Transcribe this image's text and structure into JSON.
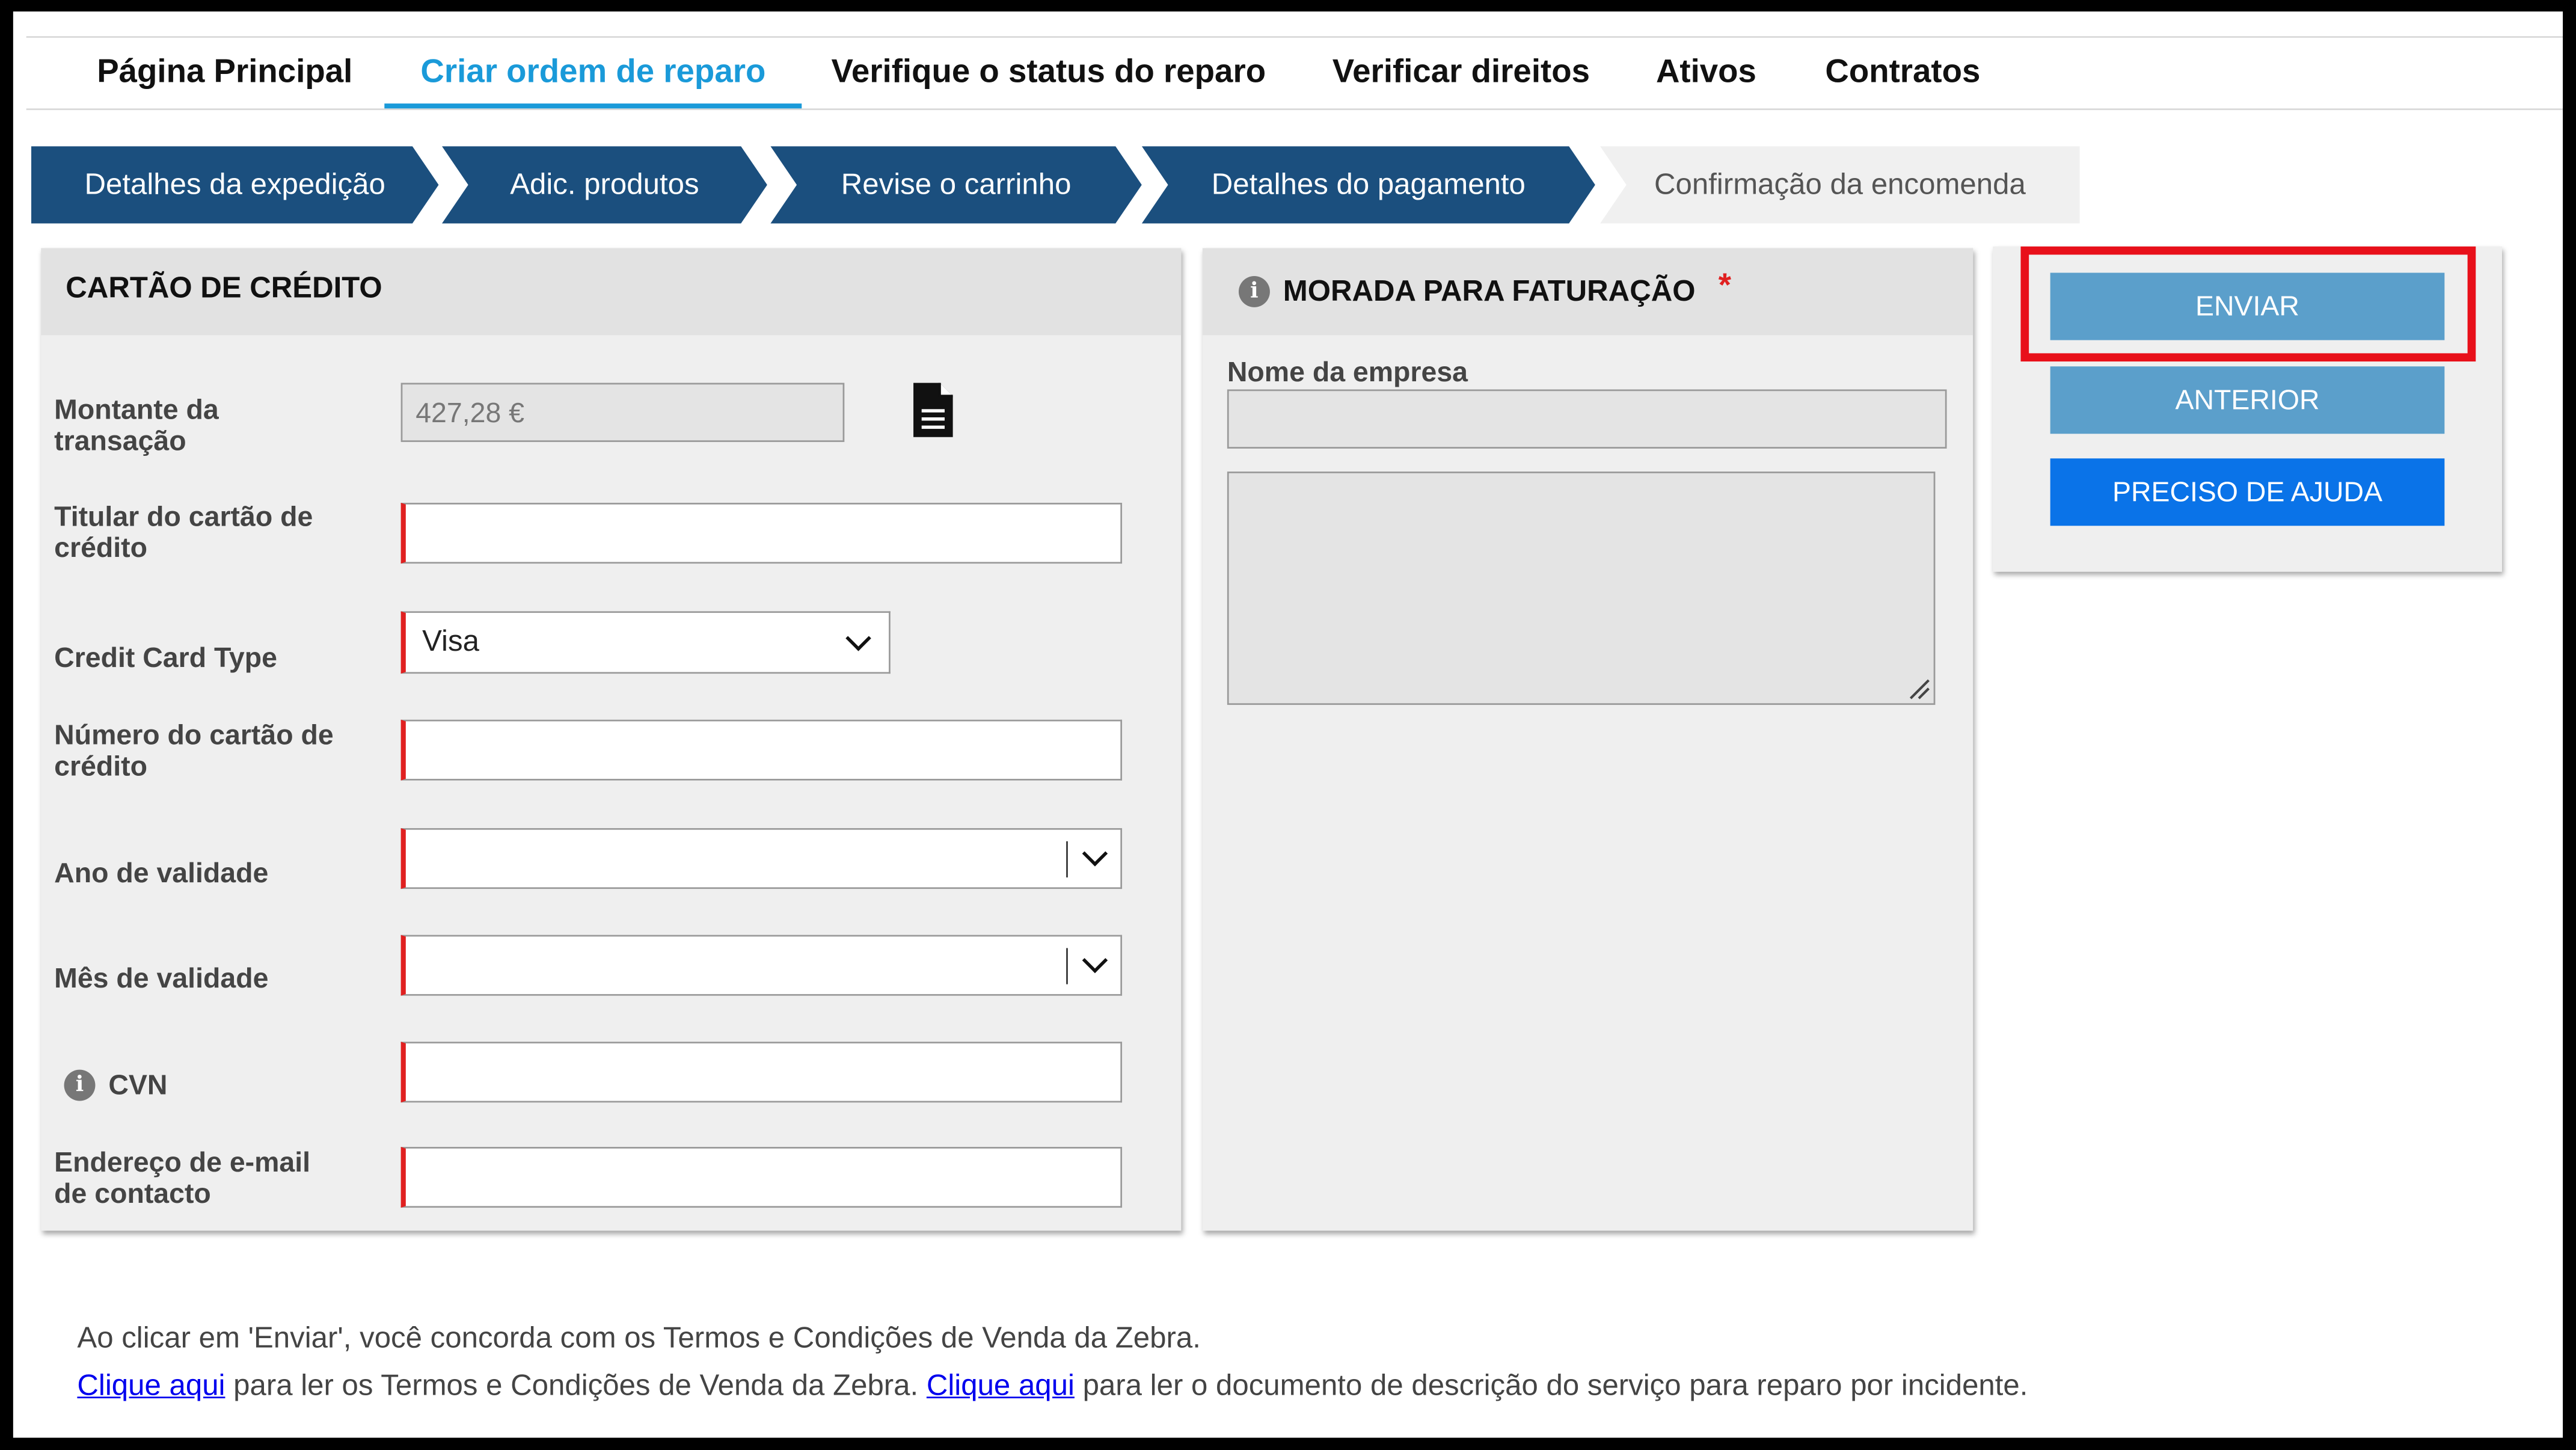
{
  "nav": {
    "items": [
      "Página Principal",
      "Criar ordem de reparo",
      "Verifique o status do reparo",
      "Verificar direitos",
      "Ativos",
      "Contratos"
    ],
    "active_index": 1
  },
  "steps": [
    "Detalhes da expedição",
    "Adic. produtos",
    "Revise o carrinho",
    "Detalhes do pagamento",
    "Confirmação da encomenda"
  ],
  "credit_card": {
    "title": "CARTÃO DE CRÉDITO",
    "amount_label_1": "Montante da",
    "amount_label_2": "transação",
    "amount_value": "427,28 €",
    "holder_label_1": "Titular do cartão de",
    "holder_label_2": "crédito",
    "holder_value": "",
    "type_label": "Credit Card Type",
    "type_value": "Visa",
    "number_label_1": "Número do cartão de",
    "number_label_2": "crédito",
    "number_value": "",
    "year_label": "Ano de validade",
    "year_value": "",
    "month_label": "Mês de validade",
    "month_value": "",
    "cvn_label": "CVN",
    "cvn_value": "",
    "email_label_1": "Endereço de e-mail",
    "email_label_2": "de contacto",
    "email_value": ""
  },
  "billing": {
    "title": "MORADA PARA FATURAÇÃO",
    "required_mark": "*",
    "company_label": "Nome da empresa",
    "company_value": "",
    "address_value": ""
  },
  "actions": {
    "submit": "ENVIAR",
    "previous": "ANTERIOR",
    "help": "PRECISO DE AJUDA"
  },
  "footer": {
    "line1": "Ao clicar em 'Enviar', você concorda com os Termos e Condições de Venda da Zebra.",
    "link1": "Clique aqui",
    "text1": " para ler os Termos e Condições de Venda da Zebra. ",
    "link2": "Clique aqui",
    "text2": " para ler o documento de descrição do serviço para reparo por incidente."
  },
  "colors": {
    "accent": "#1a9ad9",
    "step_bg": "#1b4f7e",
    "button_secondary": "#5b9fcb",
    "button_primary": "#0a73e8",
    "highlight": "#e8101a",
    "required": "#e02020"
  }
}
